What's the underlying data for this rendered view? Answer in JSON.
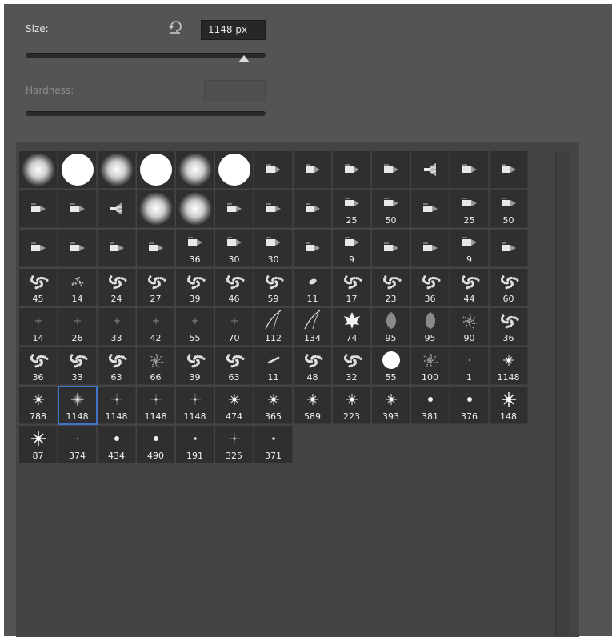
{
  "brush_options": {
    "size_label": "Size:",
    "size_value": "1148 px",
    "size_slider_fraction": 0.91,
    "hardness_label": "Hardness:",
    "hardness_value": ""
  },
  "colors": {
    "panel_bg": "#545454",
    "grid_bg": "#2f2f2f",
    "selection": "#3f74c9"
  },
  "icons": {
    "reset": "reset-icon",
    "settings": "gear-icon",
    "menu": "flyout-menu-icon"
  },
  "presets": [
    [
      "soft-round",
      ""
    ],
    [
      "hard-round",
      ""
    ],
    [
      "soft-round",
      ""
    ],
    [
      "hard-round",
      ""
    ],
    [
      "soft-round",
      ""
    ],
    [
      "hard-round",
      ""
    ],
    [
      "tip",
      ""
    ],
    [
      "tip",
      ""
    ],
    [
      "tip",
      ""
    ],
    [
      "tip",
      ""
    ],
    [
      "fan-tip",
      ""
    ],
    [
      "tip",
      ""
    ],
    [
      "tip",
      ""
    ],
    [
      "tip",
      ""
    ],
    [
      "tip",
      ""
    ],
    [
      "fan-tip",
      ""
    ],
    [
      "soft-round",
      ""
    ],
    [
      "soft-round",
      ""
    ],
    [
      "tip",
      ""
    ],
    [
      "tip",
      ""
    ],
    [
      "tip",
      ""
    ],
    [
      "tip",
      "25"
    ],
    [
      "tip",
      "50"
    ],
    [
      "tip",
      ""
    ],
    [
      "tip",
      "25"
    ],
    [
      "tip",
      "50"
    ],
    [
      "tip",
      ""
    ],
    [
      "tip",
      ""
    ],
    [
      "tip",
      ""
    ],
    [
      "tip",
      ""
    ],
    [
      "tip",
      "36"
    ],
    [
      "tip",
      "30"
    ],
    [
      "tip",
      "30"
    ],
    [
      "tip",
      ""
    ],
    [
      "tip",
      "9"
    ],
    [
      "tip",
      ""
    ],
    [
      "tip",
      ""
    ],
    [
      "tip",
      "9"
    ],
    [
      "tip",
      ""
    ],
    [
      "scatter",
      "45"
    ],
    [
      "scatter-light",
      "14"
    ],
    [
      "scatter",
      "24"
    ],
    [
      "scatter",
      "27"
    ],
    [
      "scatter",
      "39"
    ],
    [
      "scatter",
      "46"
    ],
    [
      "scatter",
      "59"
    ],
    [
      "leaf-small",
      "11"
    ],
    [
      "scatter",
      "17"
    ],
    [
      "scatter",
      "23"
    ],
    [
      "scatter",
      "36"
    ],
    [
      "scatter",
      "44"
    ],
    [
      "scatter",
      "60"
    ],
    [
      "star-small",
      "14"
    ],
    [
      "star-small",
      "26"
    ],
    [
      "star-small",
      "33"
    ],
    [
      "star-small",
      "42"
    ],
    [
      "star-small",
      "55"
    ],
    [
      "star-small",
      "70"
    ],
    [
      "grass",
      "112"
    ],
    [
      "grass",
      "134"
    ],
    [
      "maple-leaf",
      "74"
    ],
    [
      "leaf",
      "95"
    ],
    [
      "leaf",
      "95"
    ],
    [
      "texture",
      "90"
    ],
    [
      "scatter",
      "36"
    ],
    [
      "scatter",
      "36"
    ],
    [
      "scatter",
      "33"
    ],
    [
      "scatter",
      "63"
    ],
    [
      "texture",
      "66"
    ],
    [
      "scatter",
      "39"
    ],
    [
      "scatter",
      "63"
    ],
    [
      "streak",
      "11"
    ],
    [
      "scatter",
      "48"
    ],
    [
      "scatter",
      "32"
    ],
    [
      "hard-round-sm",
      "55"
    ],
    [
      "texture",
      "100"
    ],
    [
      "dot-tiny",
      "1"
    ],
    [
      "star",
      "1148"
    ],
    [
      "star",
      "788"
    ],
    [
      "star-glow",
      "1148"
    ],
    [
      "star-faint",
      "1148"
    ],
    [
      "star-faint",
      "1148"
    ],
    [
      "star-faint",
      "1148"
    ],
    [
      "star",
      "474"
    ],
    [
      "star",
      "365"
    ],
    [
      "star",
      "589"
    ],
    [
      "star",
      "223"
    ],
    [
      "star",
      "393"
    ],
    [
      "dot",
      "381"
    ],
    [
      "dot",
      "376"
    ],
    [
      "star-big",
      "148"
    ],
    [
      "star-big",
      "87"
    ],
    [
      "dot-tiny",
      "374"
    ],
    [
      "dot",
      "434"
    ],
    [
      "dot",
      "490"
    ],
    [
      "dot-small",
      "191"
    ],
    [
      "star-faint",
      "325"
    ],
    [
      "dot-small",
      "371"
    ]
  ],
  "selected_index": 79
}
